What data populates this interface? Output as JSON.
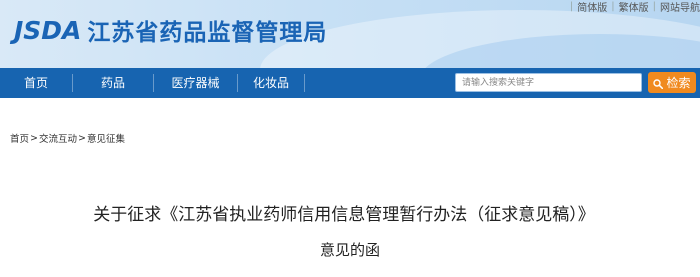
{
  "site": {
    "logo_mark": "JSDA",
    "logo_name": "江苏省药品监督管理局"
  },
  "top_links": [
    "简体版",
    "繁体版",
    "网站导航"
  ],
  "nav": {
    "items": [
      "首页",
      "药品",
      "医疗器械",
      "化妆品"
    ]
  },
  "search": {
    "placeholder": "请输入搜索关键字",
    "button_label": "检索"
  },
  "breadcrumb": [
    "首页",
    "交流互动",
    "意见征集"
  ],
  "breadcrumb_sep": ">",
  "article": {
    "title_line1": "关于征求《江苏省执业药师信用信息管理暂行办法（征求意见稿）》",
    "title_line2": "意见的函"
  },
  "colors": {
    "nav_bg": "#1764b0",
    "logo": "#1a64b5",
    "search_button": "#f08a1f"
  }
}
